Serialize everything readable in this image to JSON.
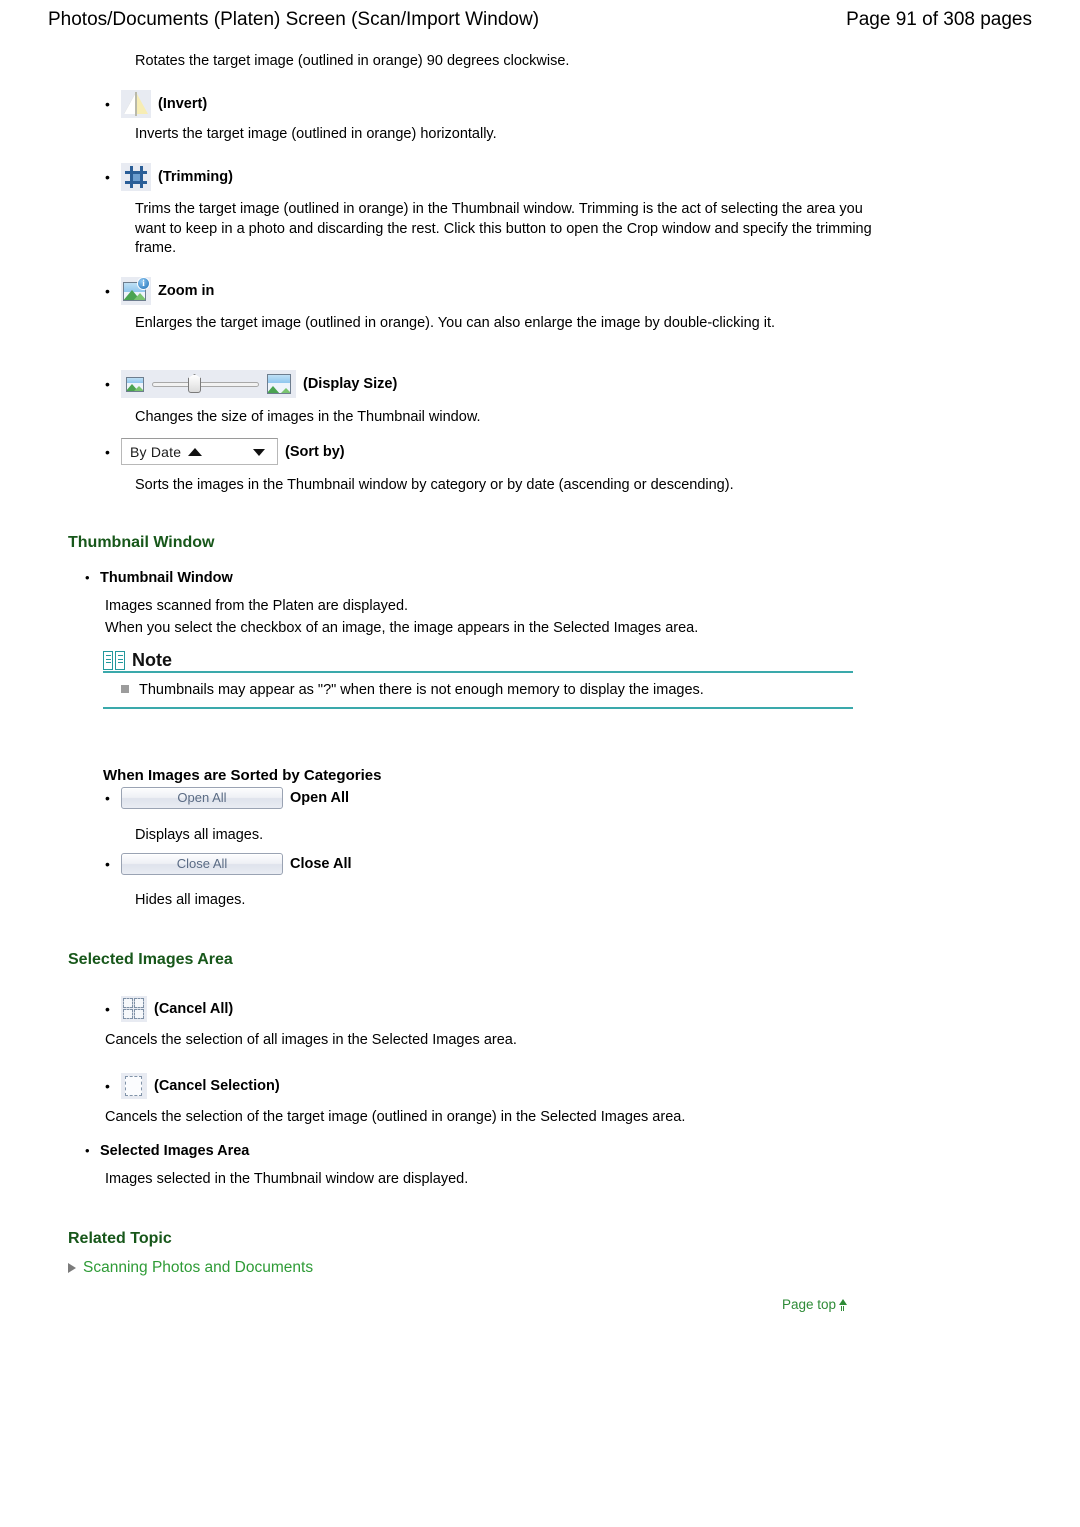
{
  "header": {
    "title": "Photos/Documents (Platen) Screen (Scan/Import Window)",
    "page_indicator": "Page 91 of 308 pages"
  },
  "colors": {
    "heading_green": "#17571a",
    "link_green": "#2e9b36",
    "note_rule": "#3aa9ab",
    "button_text": "#5a6b84"
  },
  "intro": {
    "rotate_description": "Rotates the target image (outlined in orange) 90 degrees clockwise."
  },
  "toolbar_items": [
    {
      "icon": "invert-icon",
      "label": "(Invert)",
      "description": "Inverts the target image (outlined in orange) horizontally."
    },
    {
      "icon": "trimming-icon",
      "label": "(Trimming)",
      "description": "Trims the target image (outlined in orange) in the Thumbnail window. Trimming is the act of selecting the area you want to keep in a photo and discarding the rest. Click this button to open the Crop window and specify the trimming frame."
    },
    {
      "icon": "zoom-in-icon",
      "label": "Zoom in",
      "description": "Enlarges the target image (outlined in orange). You can also enlarge the image by double-clicking it."
    },
    {
      "icon": "display-size-slider",
      "label": "(Display Size)",
      "description": "Changes the size of images in the Thumbnail window."
    },
    {
      "icon": "sort-by-dropdown",
      "label": "(Sort by)",
      "description": "Sorts the images in the Thumbnail window by category or by date (ascending or descending)."
    }
  ],
  "sort_by": {
    "value": "By Date",
    "ascending_marker": "ascending-triangle-icon",
    "caret": "chevron-down-icon"
  },
  "thumbnail_section": {
    "heading": "Thumbnail Window",
    "bullet_label": "Thumbnail Window",
    "line1": "Images scanned from the Platen are displayed.",
    "line2": "When you select the checkbox of an image, the image appears in the Selected Images area.",
    "note": {
      "title": "Note",
      "icon": "book-icon",
      "items": [
        "Thumbnails may appear as \"?\" when there is not enough memory to display the images."
      ]
    }
  },
  "categories_section": {
    "heading": "When Images are Sorted by Categories",
    "items": [
      {
        "button_label": "Open All",
        "label": "Open All",
        "description": "Displays all images."
      },
      {
        "button_label": "Close All",
        "label": "Close All",
        "description": "Hides all images."
      }
    ]
  },
  "selected_images_section": {
    "heading": "Selected Images Area",
    "items": [
      {
        "icon": "cancel-all-icon",
        "label": "(Cancel All)",
        "description": "Cancels the selection of all images in the Selected Images area."
      },
      {
        "icon": "cancel-selection-icon",
        "label": "(Cancel Selection)",
        "description": "Cancels the selection of the target image (outlined in orange) in the Selected Images area."
      }
    ],
    "bullet_label": "Selected Images Area",
    "bullet_description": "Images selected in the Thumbnail window are displayed."
  },
  "related_topic": {
    "heading": "Related Topic",
    "link": "Scanning Photos and Documents",
    "arrow_icon": "triangle-right-icon"
  },
  "page_top": {
    "label": "Page top",
    "icon": "up-arrow-icon"
  }
}
